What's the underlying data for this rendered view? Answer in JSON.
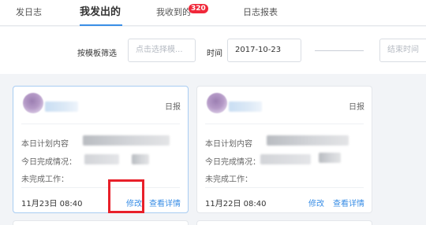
{
  "tabs": [
    {
      "label": "发日志"
    },
    {
      "label": "我发出的"
    },
    {
      "label": "我收到的",
      "badge": "320"
    },
    {
      "label": "日志报表"
    }
  ],
  "filter": {
    "template_label": "按模板筛选",
    "template_placeholder": "点击选择模...",
    "time_label": "时间",
    "start_date": "2017-10-23",
    "end_placeholder": "结束时间"
  },
  "cards": [
    {
      "type": "日报",
      "fields": [
        "本日计划内容",
        "今日完成情况：",
        "未完成工作："
      ],
      "time": "11月23日 08:40",
      "edit": "修改",
      "detail": "查看详情"
    },
    {
      "type": "日报",
      "fields": [
        "本日计划内容",
        "今日完成情况：",
        "未完成工作："
      ],
      "time": "11月22日 08:40",
      "edit": "修改",
      "detail": "查看详情"
    }
  ],
  "colors": {
    "accent": "#3a8ee6",
    "badge": "#f0283a",
    "highlight_box": "#e8202a"
  }
}
